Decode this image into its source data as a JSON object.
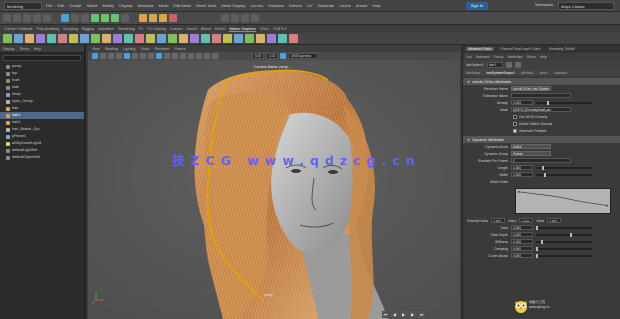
{
  "menubar": {
    "mode": "Modeling",
    "items": [
      "File",
      "Edit",
      "Create",
      "Select",
      "Modify",
      "Display",
      "Windows",
      "Mesh",
      "Edit Mesh",
      "Mesh Tools",
      "Mesh Display",
      "Curves",
      "Surfaces",
      "Deform",
      "UV",
      "Generate",
      "Cache",
      "Arnold",
      "Help"
    ],
    "user": "Sign In",
    "workspace_label": "Workspace:",
    "workspace": "Maya Classic"
  },
  "shelf_tabs": [
    "Curves / Surfaces",
    "Poly Modeling",
    "Sculpting",
    "Rigging",
    "Animation",
    "Rendering",
    "FX",
    "FX Caching",
    "Custom",
    "Arnold",
    "Bifrost",
    "MASH",
    "Motion Graphics",
    "XGen",
    "TURTLE"
  ],
  "shelf_active": 12,
  "outliner": {
    "menu": [
      "Display",
      "Show",
      "Help"
    ],
    "search_placeholder": "Search...",
    "items": [
      {
        "label": "persp",
        "icon": "camera-icon",
        "selected": false
      },
      {
        "label": "top",
        "icon": "camera-icon",
        "selected": false
      },
      {
        "label": "front",
        "icon": "camera-icon",
        "selected": false
      },
      {
        "label": "side",
        "icon": "camera-icon",
        "selected": false
      },
      {
        "label": "head",
        "icon": "mesh-icon",
        "selected": false
      },
      {
        "label": "eyes_Group",
        "icon": "group-icon",
        "selected": false
      },
      {
        "label": "hair",
        "icon": "hair-icon",
        "selected": false
      },
      {
        "label": "hair1",
        "icon": "hair-icon",
        "selected": true
      },
      {
        "label": "hair2",
        "icon": "hair-icon",
        "selected": false
      },
      {
        "label": "hair_Braids_Grp",
        "icon": "group-icon",
        "selected": false
      },
      {
        "label": "pPlane1",
        "icon": "mesh-icon",
        "selected": false
      },
      {
        "label": "aiSkyDomeLight1",
        "icon": "light-icon",
        "selected": false
      },
      {
        "label": "defaultLightSet",
        "icon": "set-icon",
        "selected": false
      },
      {
        "label": "defaultObjectSet",
        "icon": "set-icon",
        "selected": false
      }
    ]
  },
  "viewport": {
    "menu": [
      "View",
      "Shading",
      "Lighting",
      "Show",
      "Renderer",
      "Panels"
    ],
    "near_clip": "0.00",
    "far_clip": "1.00",
    "color_space": "sRGB gamma",
    "camera_label": "Camera Name: persp",
    "camera": "persp",
    "watermark": "技ZCG www.qdzcg.cn"
  },
  "attribute_editor": {
    "tabs": [
      "Attribute Editor",
      "Channel Box/Layer Editor",
      "Modeling Toolkit"
    ],
    "menu": [
      "List",
      "Selected",
      "Focus",
      "Attributes",
      "Show",
      "Help"
    ],
    "node_label": "hairSystem1",
    "node_field": "hair1",
    "node_tabs": [
      "Attributes",
      "hairSystemShape1",
      "pfxHair1",
      "time1",
      "nucleus1"
    ],
    "sections": {
      "xgen": "Arnold XGen Attributes",
      "dynamics": "Dynamic Attributes"
    },
    "xgen_rows": [
      {
        "label": "Renderer Name",
        "value": "Arnold XGen Hair Shader",
        "kind": "dropdown"
      },
      {
        "label": "Extension Name",
        "value": "",
        "kind": "text"
      },
      {
        "label": "Density",
        "value": "1.000",
        "kind": "slider",
        "level": 0.2
      },
      {
        "label": "Mask",
        "value": "${DESC}/Density/Mask.ptx",
        "kind": "text"
      }
    ],
    "checks": [
      {
        "label": "Use MUSH Density",
        "on": false
      },
      {
        "label": "Delete Hidden Strands",
        "on": false
      },
      {
        "label": "Generate Primitive",
        "on": true
      }
    ],
    "dynamics_rows": [
      {
        "label": "Dynamic Mode",
        "value": "Active",
        "kind": "dropdown"
      },
      {
        "label": "Dynamic Group",
        "value": "Parent",
        "kind": "dropdown"
      },
      {
        "label": "Simulate Per Frame",
        "value": "1",
        "kind": "text"
      },
      {
        "label": "Length",
        "value": "1.000",
        "kind": "slider",
        "level": 0.1
      },
      {
        "label": "Width",
        "value": "1.000",
        "kind": "slider",
        "level": 0.15
      }
    ],
    "ramp_label": "Width Scale",
    "ramp_fields": [
      {
        "label": "Selected Value",
        "value": "1.000"
      },
      {
        "label": "Interp",
        "value": "Linear"
      },
      {
        "label": "Value",
        "value": "1.000"
      }
    ],
    "bottom_rows": [
      {
        "label": "Twist",
        "value": "0.000"
      },
      {
        "label": "Twist Depth",
        "value": "1.000"
      },
      {
        "label": "Stiffness",
        "value": "0.150"
      },
      {
        "label": "Damping",
        "value": "0.000"
      },
      {
        "label": "Curve Attract",
        "value": "0.000"
      }
    ]
  },
  "branding": {
    "line1": "动画小工具",
    "line2": "www.qdzcg.cn"
  },
  "colors": {
    "accent": "#4f9ed8",
    "selection": "#4e6a88",
    "watermark": "#5e63ff",
    "hair_highlight": "#e5a400"
  }
}
